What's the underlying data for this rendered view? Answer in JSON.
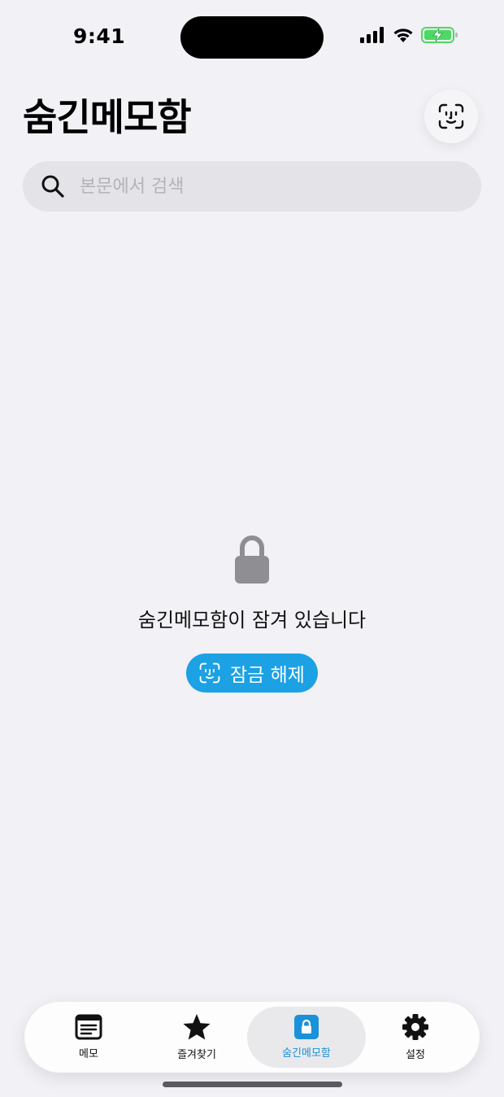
{
  "status_bar": {
    "time": "9:41",
    "icons": [
      "cellular-signal-icon",
      "wifi-icon",
      "battery-charging-icon"
    ]
  },
  "header": {
    "title": "숨긴메모함",
    "faceid_button_icon": "face-id-icon"
  },
  "search": {
    "placeholder": "본문에서 검색",
    "value": ""
  },
  "locked_state": {
    "icon": "lock-icon",
    "message": "숨긴메모함이 잠겨 있습니다",
    "unlock_button_label": "잠금 해제",
    "unlock_button_icon": "face-id-icon"
  },
  "tab_bar": {
    "tabs": [
      {
        "label": "메모",
        "icon": "memo-icon",
        "active": false
      },
      {
        "label": "즐겨찾기",
        "icon": "star-icon",
        "active": false
      },
      {
        "label": "숨긴메모함",
        "icon": "lock-icon",
        "active": true
      },
      {
        "label": "설정",
        "icon": "gear-icon",
        "active": false
      }
    ]
  },
  "colors": {
    "background": "#f2f1f6",
    "accent": "#1ba1e4",
    "active_tab_label": "#1a91d8",
    "battery": "#4cd964",
    "lock_gray": "#8e8e93"
  }
}
